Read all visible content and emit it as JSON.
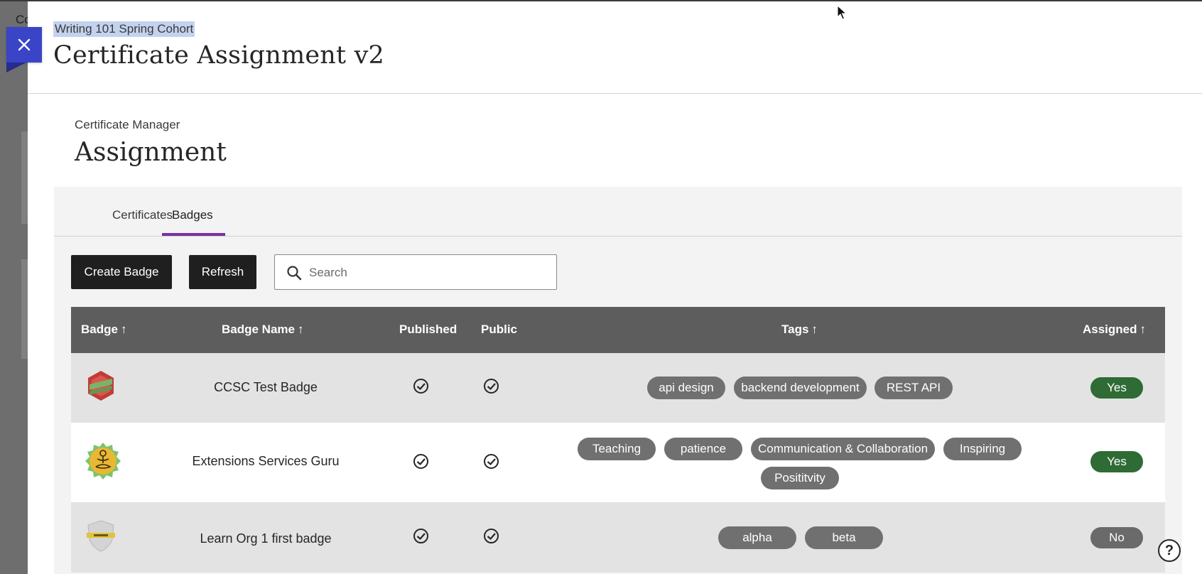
{
  "backdrop": {
    "text": "Cc"
  },
  "header": {
    "breadcrumb": "Writing 101 Spring Cohort",
    "title": "Certificate Assignment v2"
  },
  "section": {
    "breadcrumb": "Certificate Manager",
    "title": "Assignment"
  },
  "tabs": [
    {
      "label": "Certificates",
      "active": false
    },
    {
      "label": "Badges",
      "active": true
    }
  ],
  "toolbar": {
    "create_label": "Create Badge",
    "refresh_label": "Refresh",
    "search_placeholder": "Search"
  },
  "table": {
    "columns": {
      "badge": "Badge",
      "badge_name": "Badge Name",
      "published": "Published",
      "public": "Public",
      "tags": "Tags",
      "assigned": "Assigned"
    },
    "sort_arrow": "↑",
    "rows": [
      {
        "badge_icon": "hexagon-badge-icon",
        "name": "CCSC Test Badge",
        "published": true,
        "public": true,
        "tags": [
          "api design",
          "backend development",
          "REST API"
        ],
        "assigned": "Yes"
      },
      {
        "badge_icon": "meditation-badge-icon",
        "name": "Extensions Services Guru",
        "published": true,
        "public": true,
        "tags": [
          "Teaching",
          "patience",
          "Communication & Collaboration",
          "Inspiring",
          "Posititvity"
        ],
        "assigned": "Yes"
      },
      {
        "badge_icon": "shield-badge-icon",
        "name": "Learn Org 1 first badge",
        "published": true,
        "public": true,
        "tags": [
          "alpha",
          "beta"
        ],
        "assigned": "No"
      }
    ]
  },
  "colors": {
    "accent_tab": "#7a2fa3",
    "close_button": "#3a44c7",
    "assigned_yes": "#2f6b34",
    "assigned_no": "#6a6a6a",
    "tag": "#707070",
    "table_header": "#5d5d5d"
  },
  "help": {
    "label": "?"
  }
}
